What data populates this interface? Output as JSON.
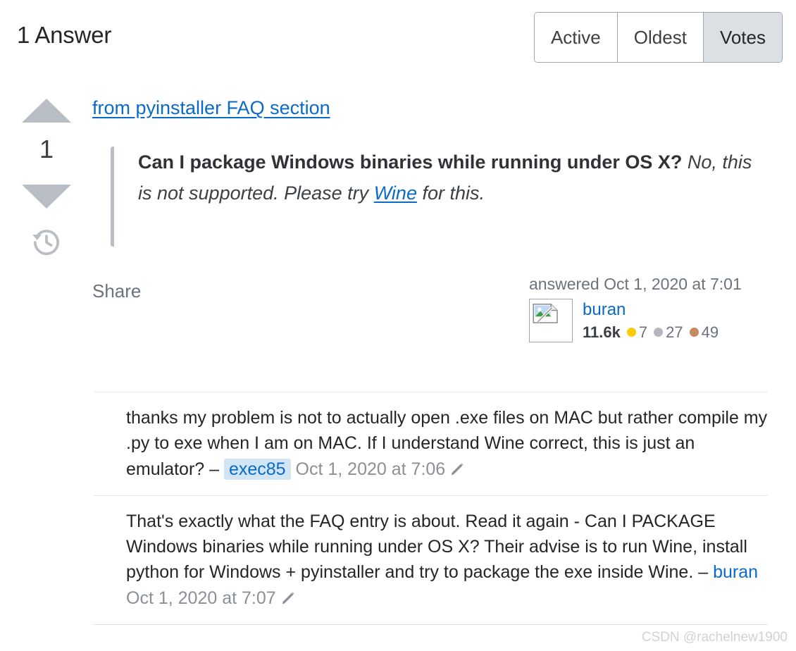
{
  "header": {
    "title": "1 Answer",
    "tabs": [
      {
        "label": "Active",
        "selected": false
      },
      {
        "label": "Oldest",
        "selected": false
      },
      {
        "label": "Votes",
        "selected": true
      }
    ]
  },
  "answer": {
    "vote_count": "1",
    "vote_up_icon": "triangle-up-icon",
    "vote_down_icon": "triangle-down-icon",
    "history_icon": "history-clock-icon",
    "intro_link": "from pyinstaller FAQ section",
    "quote": {
      "bold_part": "Can I package Windows binaries while running under OS X?",
      "italic_before": " No, this is not supported. Please try ",
      "italic_link": "Wine",
      "italic_after": " for this."
    },
    "share_label": "Share",
    "user_card": {
      "answered_label": "answered Oct 1, 2020 at 7:01",
      "avatar_icon": "broken-image-icon",
      "username": "buran",
      "reputation": "11.6k",
      "gold_count": "7",
      "silver_count": "27",
      "bronze_count": "49",
      "gold_color": "#ffcc01",
      "silver_color": "#b4b8bc",
      "bronze_color": "#c38b5f"
    }
  },
  "comments": [
    {
      "text": "thanks my problem is not to actually open .exe files on MAC but rather compile my .py to exe when I am on MAC. If I understand Wine correct, this is just an emulator?",
      "dash": " – ",
      "author": "exec85",
      "author_highlighted": true,
      "date": "Oct 1, 2020 at 7:06",
      "edit_icon": "pencil-icon"
    },
    {
      "text": "That's exactly what the FAQ entry is about. Read it again - Can I PACKAGE Windows binaries while running under OS X? Their advise is to run Wine, install python for Windows + pyinstaller and try to package the exe inside Wine.",
      "dash": " – ",
      "author": "buran",
      "author_highlighted": false,
      "date": "Oct 1, 2020 at 7:07",
      "edit_icon": "pencil-icon"
    }
  ],
  "watermark": "CSDN @rachelnew1900",
  "colors": {
    "link": "#0b6ac7",
    "text": "#232629",
    "muted": "#6a737c",
    "selected_tab_bg": "#dbe0e4",
    "quote_bar": "#b8bec4",
    "highlight_chip_bg": "#d1e5f5"
  }
}
